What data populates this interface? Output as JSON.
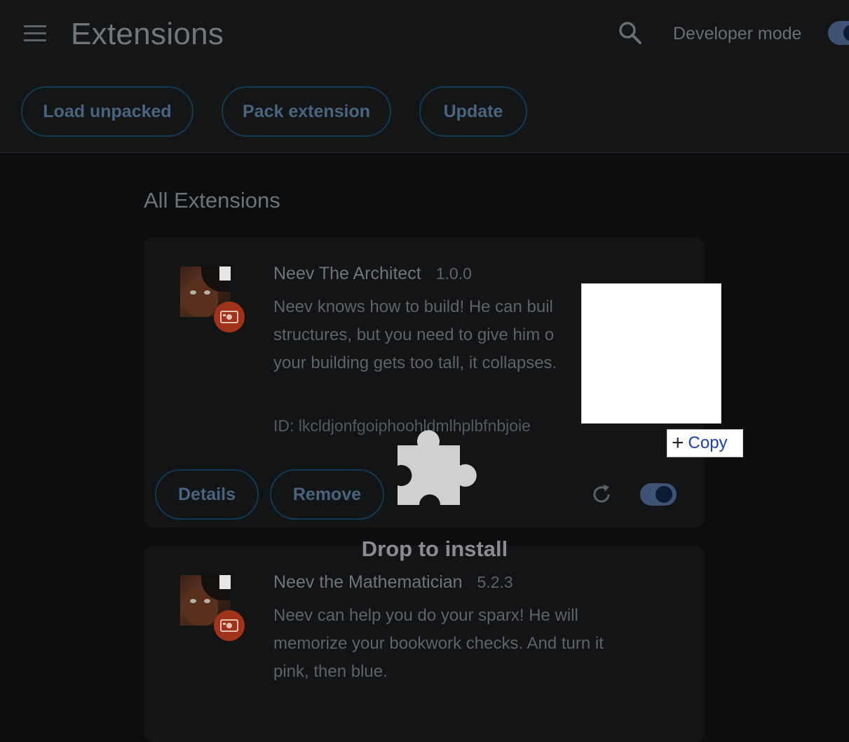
{
  "header": {
    "title": "Extensions",
    "developer_mode_label": "Developer mode",
    "developer_mode_enabled": true,
    "buttons": {
      "load_unpacked": "Load unpacked",
      "pack_extension": "Pack extension",
      "update": "Update"
    }
  },
  "section_title": "All Extensions",
  "extensions": [
    {
      "name": "Neev The Architect",
      "version": "1.0.0",
      "description": "Neev knows how to build! He can build structures, but you need to give him o... your building gets too tall, it collapses.",
      "desc_lines": [
        "Neev knows how to build! He can buil",
        "structures, but you need to give him o",
        "your building gets too tall, it collapses."
      ],
      "id_text": "ID: lkcldjonfgoiphoohldmlhplbfnbjoie",
      "details_label": "Details",
      "remove_label": "Remove",
      "enabled": true
    },
    {
      "name": "Neev the Mathematician",
      "version": "5.2.3",
      "desc_lines": [
        "Neev can help you do your sparx! He will",
        "memorize your bookwork checks. And turn it",
        "pink, then blue."
      ]
    }
  ],
  "drag": {
    "copy_label": "Copy",
    "drop_label": "Drop to install"
  },
  "icons": {
    "menu": "hamburger-menu-icon",
    "search": "search-icon",
    "reload": "reload-icon",
    "badge": "unpacked-extension-badge-icon",
    "puzzle": "puzzle-piece-icon"
  },
  "colors": {
    "accent_toggle": "#3d5275",
    "badge": "#a2331b",
    "button_border": "#0f3a52"
  }
}
